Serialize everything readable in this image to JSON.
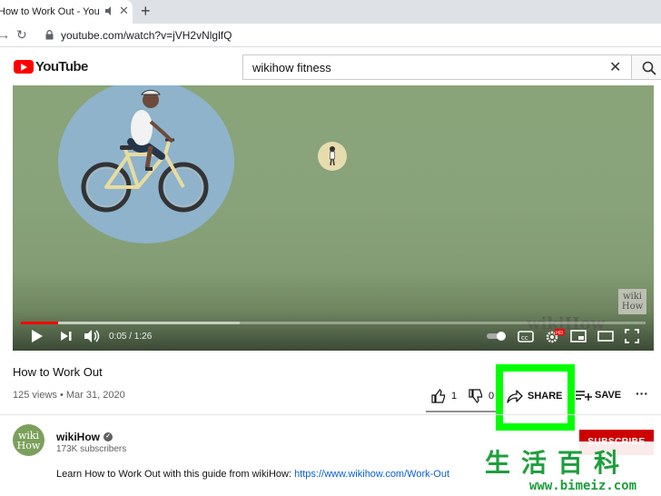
{
  "browser": {
    "tab_title": "How to Work Out - YouTube",
    "tab_close": "✕",
    "new_tab": "+",
    "url": "youtube.com/watch?v=jVH2vNlglfQ"
  },
  "youtube": {
    "logo_text": "YouTube",
    "search_value": "wikihow fitness",
    "search_clear": "✕"
  },
  "player": {
    "time": "0:05 / 1:26",
    "progress_played": 0.06,
    "progress_buffered": 0.35,
    "badge_line1": "wiki",
    "badge_line2": "How",
    "watermark": "wikiHow",
    "progress_color": "#ff0000",
    "hd_badge": "HD"
  },
  "video": {
    "title": "How to Work Out",
    "meta": "125 views • Mar 31, 2020",
    "likes": "1",
    "dislikes": "0",
    "share_label": "SHARE",
    "save_label": "SAVE",
    "more": "···"
  },
  "channel": {
    "avatar_line1": "wiki",
    "avatar_line2": "How",
    "name": "wikiHow",
    "subscribers": "173K subscribers",
    "subscribe_label": "SUBSCRIBE"
  },
  "description": {
    "text": "Learn How to Work Out with this guide from wikiHow: ",
    "link": "https://www.wikihow.com/Work-Out"
  },
  "overlay": {
    "highlight_color": "#00ff00",
    "corner_chars": "生活百科",
    "corner_url": "www.bimeiz.com"
  }
}
